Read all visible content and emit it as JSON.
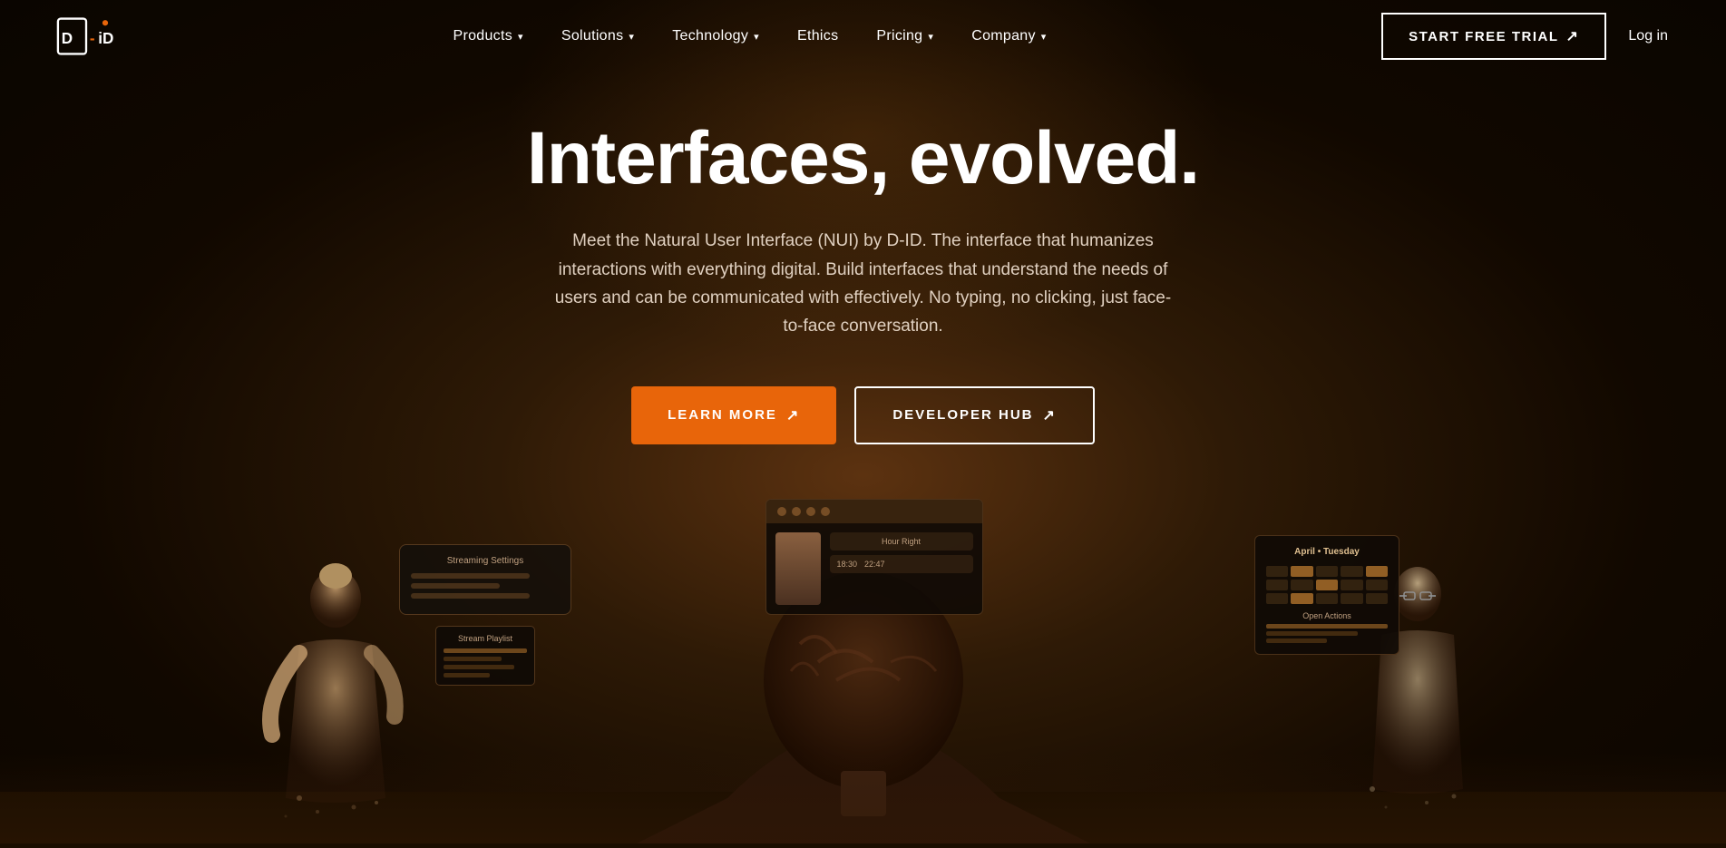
{
  "nav": {
    "logo_text": "D-ID",
    "links": [
      {
        "label": "Products",
        "has_dropdown": true
      },
      {
        "label": "Solutions",
        "has_dropdown": true
      },
      {
        "label": "Technology",
        "has_dropdown": true
      },
      {
        "label": "Ethics",
        "has_dropdown": false
      },
      {
        "label": "Pricing",
        "has_dropdown": true
      },
      {
        "label": "Company",
        "has_dropdown": true
      }
    ],
    "cta_label": "START FREE TRIAL",
    "login_label": "Log in"
  },
  "hero": {
    "title": "Interfaces, evolved.",
    "subtitle": "Meet the Natural User Interface (NUI) by D-ID. The interface that humanizes interactions with everything digital. Build interfaces that understand the needs of users and can be communicated with effectively. No typing, no clicking, just face-to-face conversation.",
    "btn_learn": "LEARN MORE",
    "btn_devhub": "DEVELOPER HUB"
  },
  "icons": {
    "arrow_diagonal": "↗",
    "chevron_down": "∨"
  }
}
